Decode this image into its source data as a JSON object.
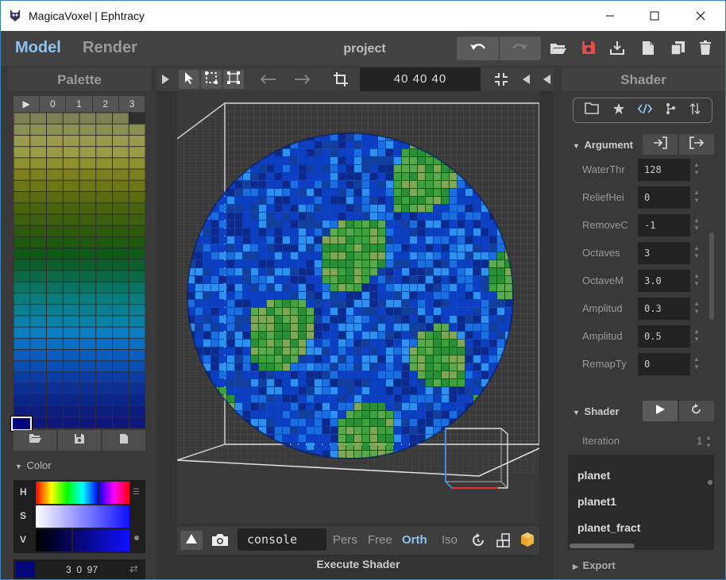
{
  "window": {
    "title": "MagicaVoxel | Ephtracy"
  },
  "topbar": {
    "tab_model": "Model",
    "tab_render": "Render",
    "project": "project"
  },
  "palette": {
    "title": "Palette",
    "tabs": [
      "▶",
      "0",
      "1",
      "2",
      "3"
    ],
    "row_colors": [
      "#7f7f55",
      "#8a8f52",
      "#999a4d",
      "#9a9b46",
      "#8e8f2d",
      "#7d7f1f",
      "#6d7514",
      "#5c6a12",
      "#49640f",
      "#3e5f0d",
      "#2f5a0b",
      "#1d5a0d",
      "#0f5a16",
      "#0a5f2c",
      "#0a6a48",
      "#0a7361",
      "#0b7c7c",
      "#0a7f92",
      "#0a81a6",
      "#0a7ec0",
      "#0a6fc2",
      "#0a5cbf",
      "#0a4db3",
      "#0b3da5",
      "#0c2f96",
      "#0c2588",
      "#0c1d7e",
      "#0d177a"
    ]
  },
  "color": {
    "section_label": "Color",
    "h_label": "H",
    "s_label": "S",
    "v_label": "V",
    "values": "3  0  97",
    "selected_hex": "#06067c"
  },
  "viewport": {
    "dims": "40  40  40",
    "console": "console",
    "modes": [
      "Pers",
      "Free",
      "Orth",
      "Iso"
    ],
    "active_mode": "Orth",
    "execute": "Execute Shader",
    "planet_colors": [
      "#0b2a8e",
      "#0c3fc2",
      "#1a6ee0",
      "#2f90f0",
      "#2b8f3a",
      "#3fa040",
      "#5aa850",
      "#7ea858",
      "#123f9e"
    ]
  },
  "shader_panel": {
    "title": "Shader",
    "argument_label": "Argument",
    "args": [
      {
        "name": "WaterThr",
        "value": "128"
      },
      {
        "name": "ReliefHei",
        "value": "0"
      },
      {
        "name": "RemoveC",
        "value": "-1"
      },
      {
        "name": "Octaves",
        "value": "3"
      },
      {
        "name": "OctaveM",
        "value": "3.0"
      },
      {
        "name": "Amplitud",
        "value": "0.3"
      },
      {
        "name": "Amplitud",
        "value": "0.5"
      },
      {
        "name": "RemapTy",
        "value": "0"
      }
    ],
    "shader_label": "Shader",
    "iteration_label": "Iteration",
    "iteration_value": "1",
    "shaders": [
      "planet",
      "planet1",
      "planet_fract"
    ],
    "export_label": "Export"
  },
  "colors": {
    "accent": "#8fc3ef",
    "save_red": "#e84a4a",
    "cube_orange": "#f2b43a"
  }
}
